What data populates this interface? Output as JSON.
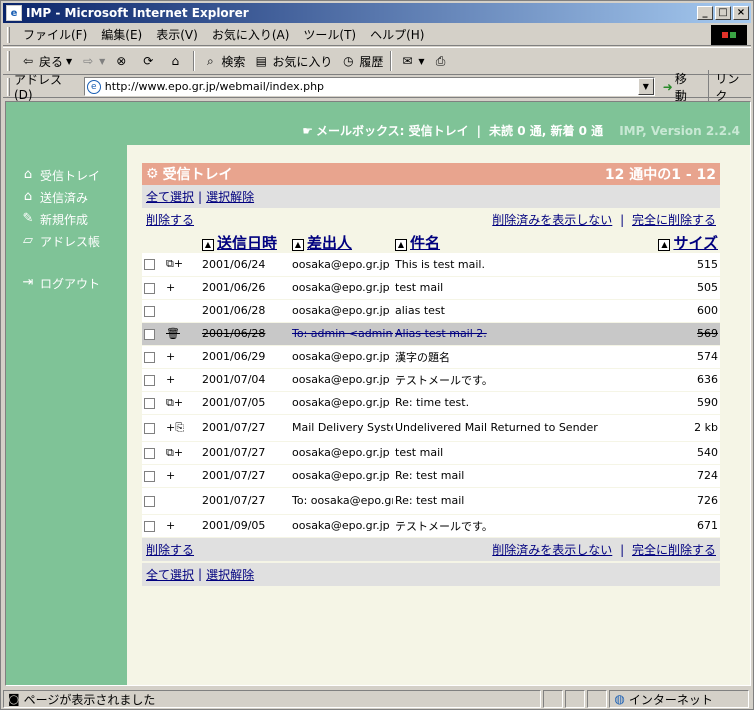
{
  "window": {
    "title": "IMP - Microsoft Internet Explorer"
  },
  "menu": [
    "ファイル(F)",
    "編集(E)",
    "表示(V)",
    "お気に入り(A)",
    "ツール(T)",
    "ヘルプ(H)"
  ],
  "toolbar": {
    "back": "戻る",
    "forward": "",
    "search": "検索",
    "favorites": "お気に入り",
    "history": "履歴"
  },
  "address": {
    "label": "アドレス(D)",
    "url": "http://www.epo.gr.jp/webmail/index.php",
    "go": "移動",
    "links": "リンク"
  },
  "topbar": {
    "mailbox_label": "メールボックス: 受信トレイ",
    "sep": "|",
    "unread": "未読 0 通, 新着 0 通",
    "version": "IMP, Version 2.2.4"
  },
  "nav": {
    "inbox": "受信トレイ",
    "sent": "送信済み",
    "compose": "新規作成",
    "addressbook": "アドレス帳",
    "logout": "ログアウト"
  },
  "mailbox": {
    "title": "受信トレイ",
    "count": "12 通中の1 - 12",
    "select_all": "全て選択",
    "deselect": "選択解除",
    "delete": "削除する",
    "hide_deleted": "削除済みを表示しない",
    "purge": "完全に削除する",
    "sep": "|",
    "columns": {
      "date": "送信日時",
      "from": "差出人",
      "subject": "件名",
      "size": "サイズ"
    },
    "messages": [
      {
        "flag": "⧉+",
        "date": "2001/06/24",
        "from": "oosaka@epo.gr.jp",
        "subject": "This is test mail.",
        "size": "515"
      },
      {
        "flag": "+",
        "date": "2001/06/26",
        "from": "oosaka@epo.gr.jp",
        "subject": "test mail",
        "size": "505"
      },
      {
        "flag": "",
        "date": "2001/06/28",
        "from": "oosaka@epo.gr.jp",
        "subject": "alias test",
        "size": "600"
      },
      {
        "flag": "🗑",
        "date": "2001/06/28",
        "from": "To: admin <admin@epo...",
        "subject": "Alias test mail 2.",
        "size": "569",
        "deleted": true
      },
      {
        "flag": "+",
        "date": "2001/06/29",
        "from": "oosaka@epo.gr.jp",
        "subject": "漢字の題名",
        "size": "574"
      },
      {
        "flag": "+",
        "date": "2001/07/04",
        "from": "oosaka@epo.gr.jp",
        "subject": "テストメールです。",
        "size": "636"
      },
      {
        "flag": "⧉+",
        "date": "2001/07/05",
        "from": "oosaka@epo.gr.jp",
        "subject": "Re: time test.",
        "size": "590"
      },
      {
        "flag": "+⎘",
        "date": "2001/07/27",
        "from": "Mail Delivery System",
        "subject": "Undelivered Mail Returned to Sender",
        "size": "2 kb",
        "tall": true
      },
      {
        "flag": "⧉+",
        "date": "2001/07/27",
        "from": "oosaka@epo.gr.jp",
        "subject": "test mail",
        "size": "540"
      },
      {
        "flag": "+",
        "date": "2001/07/27",
        "from": "oosaka@epo.gr.jp",
        "subject": "Re: test mail",
        "size": "724"
      },
      {
        "flag": "",
        "date": "2001/07/27",
        "from": "To: oosaka@epo.gr.jp",
        "subject": "Re: test mail",
        "size": "726",
        "tall": true
      },
      {
        "flag": "+",
        "date": "2001/09/05",
        "from": "oosaka@epo.gr.jp",
        "subject": "テストメールです。",
        "size": "671"
      }
    ]
  },
  "status": {
    "text": "ページが表示されました",
    "zone": "インターネット"
  }
}
